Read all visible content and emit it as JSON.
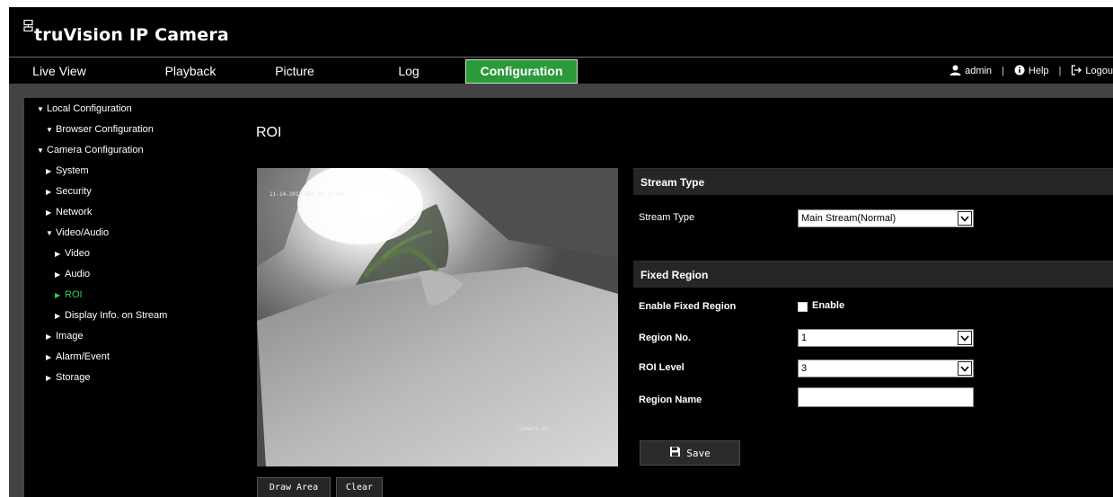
{
  "header": {
    "brand": "truVision",
    "product": "IP Camera"
  },
  "nav": {
    "tabs": [
      {
        "label": "Live View"
      },
      {
        "label": "Playback"
      },
      {
        "label": "Picture"
      },
      {
        "label": "Log"
      },
      {
        "label": "Configuration",
        "active": true
      }
    ],
    "user": "admin",
    "help": "Help",
    "logout": "Logou",
    "separator": "|",
    "accent": "#2a9a3a"
  },
  "sidebar": {
    "items": [
      {
        "label": "Local Configuration",
        "arrow": "▼"
      },
      {
        "label": "Browser Configuration",
        "arrow": "▼"
      },
      {
        "label": "Camera Configuration",
        "arrow": "▼"
      },
      {
        "label": "System",
        "arrow": "▶"
      },
      {
        "label": "Security",
        "arrow": "▶"
      },
      {
        "label": "Network",
        "arrow": "▶"
      },
      {
        "label": "Video/Audio",
        "arrow": "▼"
      },
      {
        "label": "Video",
        "arrow": "▶"
      },
      {
        "label": "Audio",
        "arrow": "▶"
      },
      {
        "label": "ROI",
        "arrow": "▶",
        "selected": true
      },
      {
        "label": "Display Info. on Stream",
        "arrow": "▶"
      },
      {
        "label": "Image",
        "arrow": "▶"
      },
      {
        "label": "Alarm/Event",
        "arrow": "▶"
      },
      {
        "label": "Storage",
        "arrow": "▶"
      }
    ],
    "selected_color": "#2fd14d"
  },
  "content": {
    "title": "ROI",
    "video": {
      "osd_datetime": "11-14-2017 Wed 01:52:41",
      "osd_camera": "Camera 01"
    },
    "draw_area_label": "Draw Area",
    "clear_label": "Clear",
    "stream_section": {
      "heading": "Stream Type",
      "label": "Stream Type",
      "value": "Main Stream(Normal)"
    },
    "fixed_region": {
      "heading": "Fixed Region",
      "enable_label": "Enable Fixed Region",
      "enable_text": "Enable",
      "region_no_label": "Region No.",
      "region_no_value": "1",
      "roi_level_label": "ROI Level",
      "roi_level_value": "3",
      "region_name_label": "Region Name",
      "region_name_value": ""
    },
    "save_label": "Save"
  }
}
